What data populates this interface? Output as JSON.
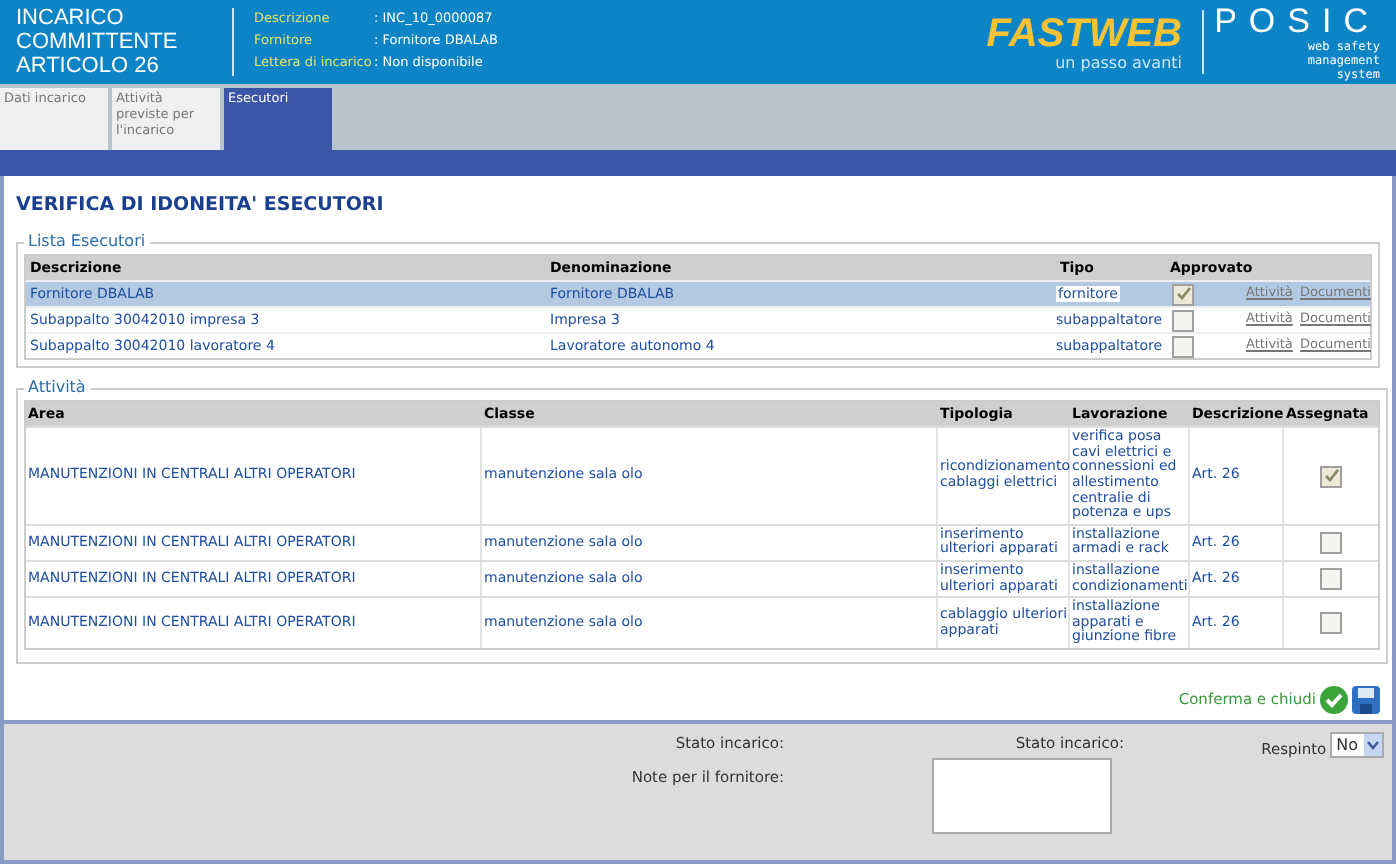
{
  "header": {
    "title": "INCARICO COMMITTENTE ARTICOLO 26",
    "info": [
      {
        "label": "Descrizione",
        "value": ": INC_10_0000087"
      },
      {
        "label": "Fornitore",
        "value": ": Fornitore DBALAB"
      },
      {
        "label": "Lettera di incarico",
        "value": ": Non disponibile"
      }
    ],
    "brand": {
      "name": "FASTWEB",
      "tagline": "un passo avanti"
    },
    "product": {
      "name": "POSIC",
      "tagline": "web safety management system"
    }
  },
  "tabs": [
    {
      "label": "Dati incarico",
      "selected": false
    },
    {
      "label": "Attività previste per l'incarico",
      "selected": false
    },
    {
      "label": "Esecutori",
      "selected": true
    }
  ],
  "heading": "VERIFICA DI IDONEITA' ESECUTORI",
  "executors": {
    "legend": "Lista Esecutori",
    "columns": [
      "Descrizione",
      "Denominazione",
      "Tipo",
      "Approvato"
    ],
    "rows": [
      {
        "descrizione": "Fornitore DBALAB",
        "denominazione": "Fornitore DBALAB",
        "tipo": "fornitore",
        "approvato": true,
        "selected": true,
        "links": [
          "Attività",
          "Documenti"
        ]
      },
      {
        "descrizione": "Subappalto 30042010 impresa 3",
        "denominazione": "Impresa 3",
        "tipo": "subappaltatore",
        "approvato": false,
        "selected": false,
        "links": [
          "Attività",
          "Documenti"
        ]
      },
      {
        "descrizione": "Subappalto 30042010 lavoratore 4",
        "denominazione": "Lavoratore autonomo 4",
        "tipo": "subappaltatore",
        "approvato": false,
        "selected": false,
        "links": [
          "Attività",
          "Documenti"
        ]
      }
    ]
  },
  "activities": {
    "legend": "Attività",
    "columns": [
      "Area",
      "Classe",
      "Tipologia",
      "Lavorazione",
      "Descrizione",
      "Assegnata"
    ],
    "rows": [
      {
        "area": "MANUTENZIONI IN CENTRALI ALTRI OPERATORI",
        "classe": "manutenzione sala olo",
        "tipologia": "ricondizionamento cablaggi elettrici",
        "lavorazione": "verifica posa cavi elettrici e connessioni ed allestimento centralie di potenza e ups",
        "descrizione": "Art. 26",
        "assegnata": true
      },
      {
        "area": "MANUTENZIONI IN CENTRALI ALTRI OPERATORI",
        "classe": "manutenzione sala olo",
        "tipologia": "inserimento ulteriori apparati",
        "lavorazione": "installazione armadi e rack",
        "descrizione": "Art. 26",
        "assegnata": false
      },
      {
        "area": "MANUTENZIONI IN CENTRALI ALTRI OPERATORI",
        "classe": "manutenzione sala olo",
        "tipologia": "inserimento ulteriori apparati",
        "lavorazione": "installazione condizionamenti",
        "descrizione": "Art. 26",
        "assegnata": false
      },
      {
        "area": "MANUTENZIONI IN CENTRALI ALTRI OPERATORI",
        "classe": "manutenzione sala olo",
        "tipologia": "cablaggio ulteriori apparati",
        "lavorazione": "installazione apparati e giunzione fibre",
        "descrizione": "Art. 26",
        "assegnata": false
      }
    ]
  },
  "confirm": "Conferma e chiudi",
  "footer": {
    "stato_labels": [
      "Stato incarico:",
      "Stato incarico:"
    ],
    "note_label": "Note per il fornitore:",
    "respinto_label": "Respinto",
    "respinto_value": "No"
  }
}
